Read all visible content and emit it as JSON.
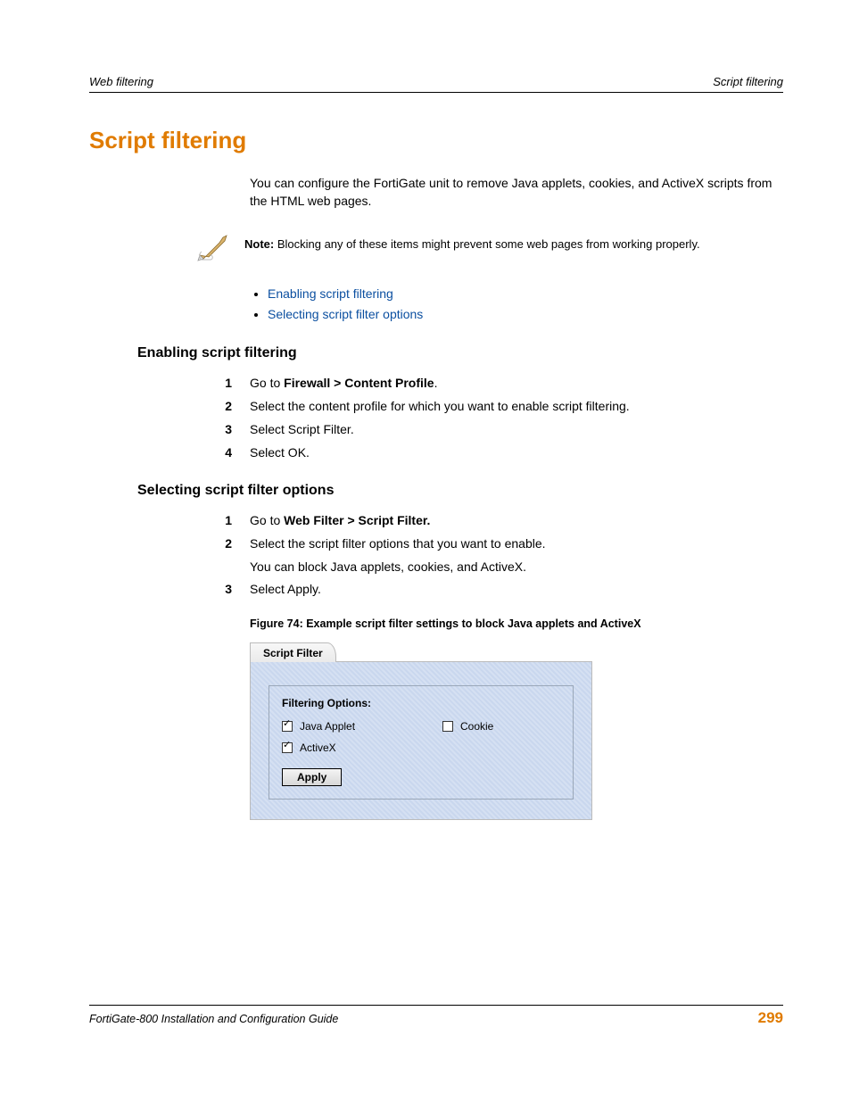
{
  "header": {
    "left": "Web filtering",
    "right": "Script filtering"
  },
  "title": "Script filtering",
  "intro": "You can configure the FortiGate unit to remove Java applets, cookies, and ActiveX scripts from the HTML web pages.",
  "note": {
    "label": "Note:",
    "text": " Blocking any of these items might prevent some web pages from working properly."
  },
  "toc": [
    "Enabling script filtering",
    "Selecting script filter options"
  ],
  "section1": {
    "heading": "Enabling script filtering",
    "steps": [
      {
        "num": "1",
        "prefix": "Go to ",
        "bold": "Firewall > Content Profile",
        "suffix": "."
      },
      {
        "num": "2",
        "text": "Select the content profile for which you want to enable script filtering."
      },
      {
        "num": "3",
        "text": "Select Script Filter."
      },
      {
        "num": "4",
        "text": "Select OK."
      }
    ]
  },
  "section2": {
    "heading": "Selecting script filter options",
    "steps": [
      {
        "num": "1",
        "prefix": "Go to ",
        "bold": "Web Filter > Script Filter."
      },
      {
        "num": "2",
        "text": "Select the script filter options that you want to enable.",
        "sub": "You can block Java applets, cookies, and ActiveX."
      },
      {
        "num": "3",
        "text": "Select Apply."
      }
    ]
  },
  "figure": {
    "caption": "Figure 74: Example script filter settings to block Java applets and ActiveX",
    "tab": "Script Filter",
    "panel_heading": "Filtering Options:",
    "options": {
      "java": {
        "label": "Java Applet",
        "checked": true
      },
      "cookie": {
        "label": "Cookie",
        "checked": false
      },
      "activex": {
        "label": "ActiveX",
        "checked": true
      }
    },
    "apply": "Apply"
  },
  "footer": {
    "left": "FortiGate-800 Installation and Configuration Guide",
    "right": "299"
  }
}
